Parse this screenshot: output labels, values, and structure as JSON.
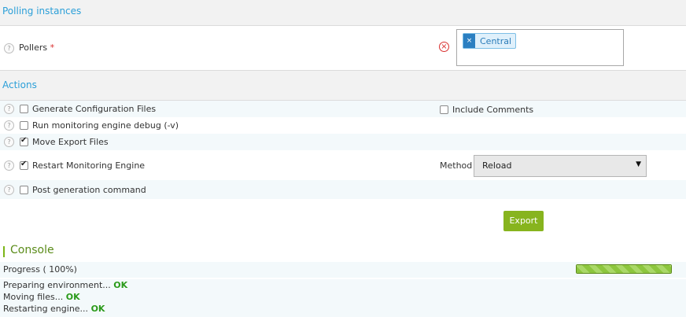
{
  "polling": {
    "section_title": "Polling instances",
    "pollers_label": "Pollers",
    "required_mark": "*",
    "selected_tags": [
      "Central"
    ],
    "tag_remove_glyph": "×"
  },
  "actions": {
    "section_title": "Actions",
    "items": [
      {
        "label": "Generate Configuration Files",
        "checked": false
      },
      {
        "label": "Run monitoring engine debug (-v)",
        "checked": false
      },
      {
        "label": "Move Export Files",
        "checked": true
      },
      {
        "label": "Restart Monitoring Engine",
        "checked": true
      },
      {
        "label": "Post generation command",
        "checked": false
      }
    ],
    "include_comments": {
      "label": "Include Comments",
      "checked": false
    },
    "method_label": "Method",
    "method_value": "Reload",
    "export_label": "Export"
  },
  "console": {
    "title": "Console",
    "progress_prefix": "Progress (",
    "progress_value": "100%)",
    "progress_fraction": 1.0,
    "lines": [
      {
        "text": "Preparing environment...",
        "status": "OK"
      },
      {
        "text": "Moving files...",
        "status": "OK"
      },
      {
        "text": "Restarting engine...",
        "status": "OK"
      }
    ]
  },
  "icons": {
    "help": "help-icon",
    "clear": "clear-icon",
    "dropdown": "chevron-down-icon"
  },
  "colors": {
    "accent_blue": "#2b9fd8",
    "export_green": "#87b41e",
    "ok_green": "#2a9a1a",
    "required_red": "#d9302f"
  }
}
